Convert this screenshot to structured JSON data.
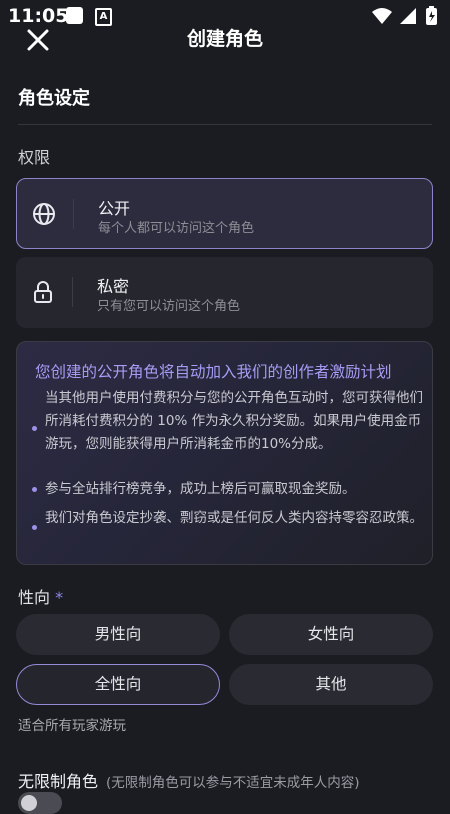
{
  "status": {
    "time": "11:05",
    "a_icon_letter": "A"
  },
  "header": {
    "title": "创建角色"
  },
  "section": {
    "title": "角色设定"
  },
  "permission": {
    "label": "权限",
    "options": [
      {
        "title": "公开",
        "subtitle": "每个人都可以访问这个角色",
        "icon": "globe-icon",
        "selected": true
      },
      {
        "title": "私密",
        "subtitle": "只有您可以访问这个角色",
        "icon": "lock-icon",
        "selected": false
      }
    ]
  },
  "info": {
    "title": "您创建的公开角色将自动加入我们的创作者激励计划",
    "bullets": [
      "当其他用户使用付费积分与您的公开角色互动时，您可获得他们所消耗付费积分的 10% 作为永久积分奖励。如果用户使用金币游玩，您则能获得用户所消耗金币的10%分成。",
      "参与全站排行榜竞争，成功上榜后可赢取现金奖励。",
      "我们对角色设定抄袭、剽窃或是任何反人类内容持零容忍政策。"
    ]
  },
  "orientation": {
    "label": "性向",
    "required_mark": "*",
    "options": [
      "男性向",
      "女性向",
      "全性向",
      "其他"
    ],
    "selected": "全性向",
    "note": "适合所有玩家游玩"
  },
  "unrestricted": {
    "label": "无限制角色",
    "note": "(无限制角色可以参与不适宜未成年人内容)",
    "enabled": false
  },
  "colors": {
    "accent": "#958ad6",
    "info_title": "#a79cf5",
    "background": "#1b1c22"
  }
}
